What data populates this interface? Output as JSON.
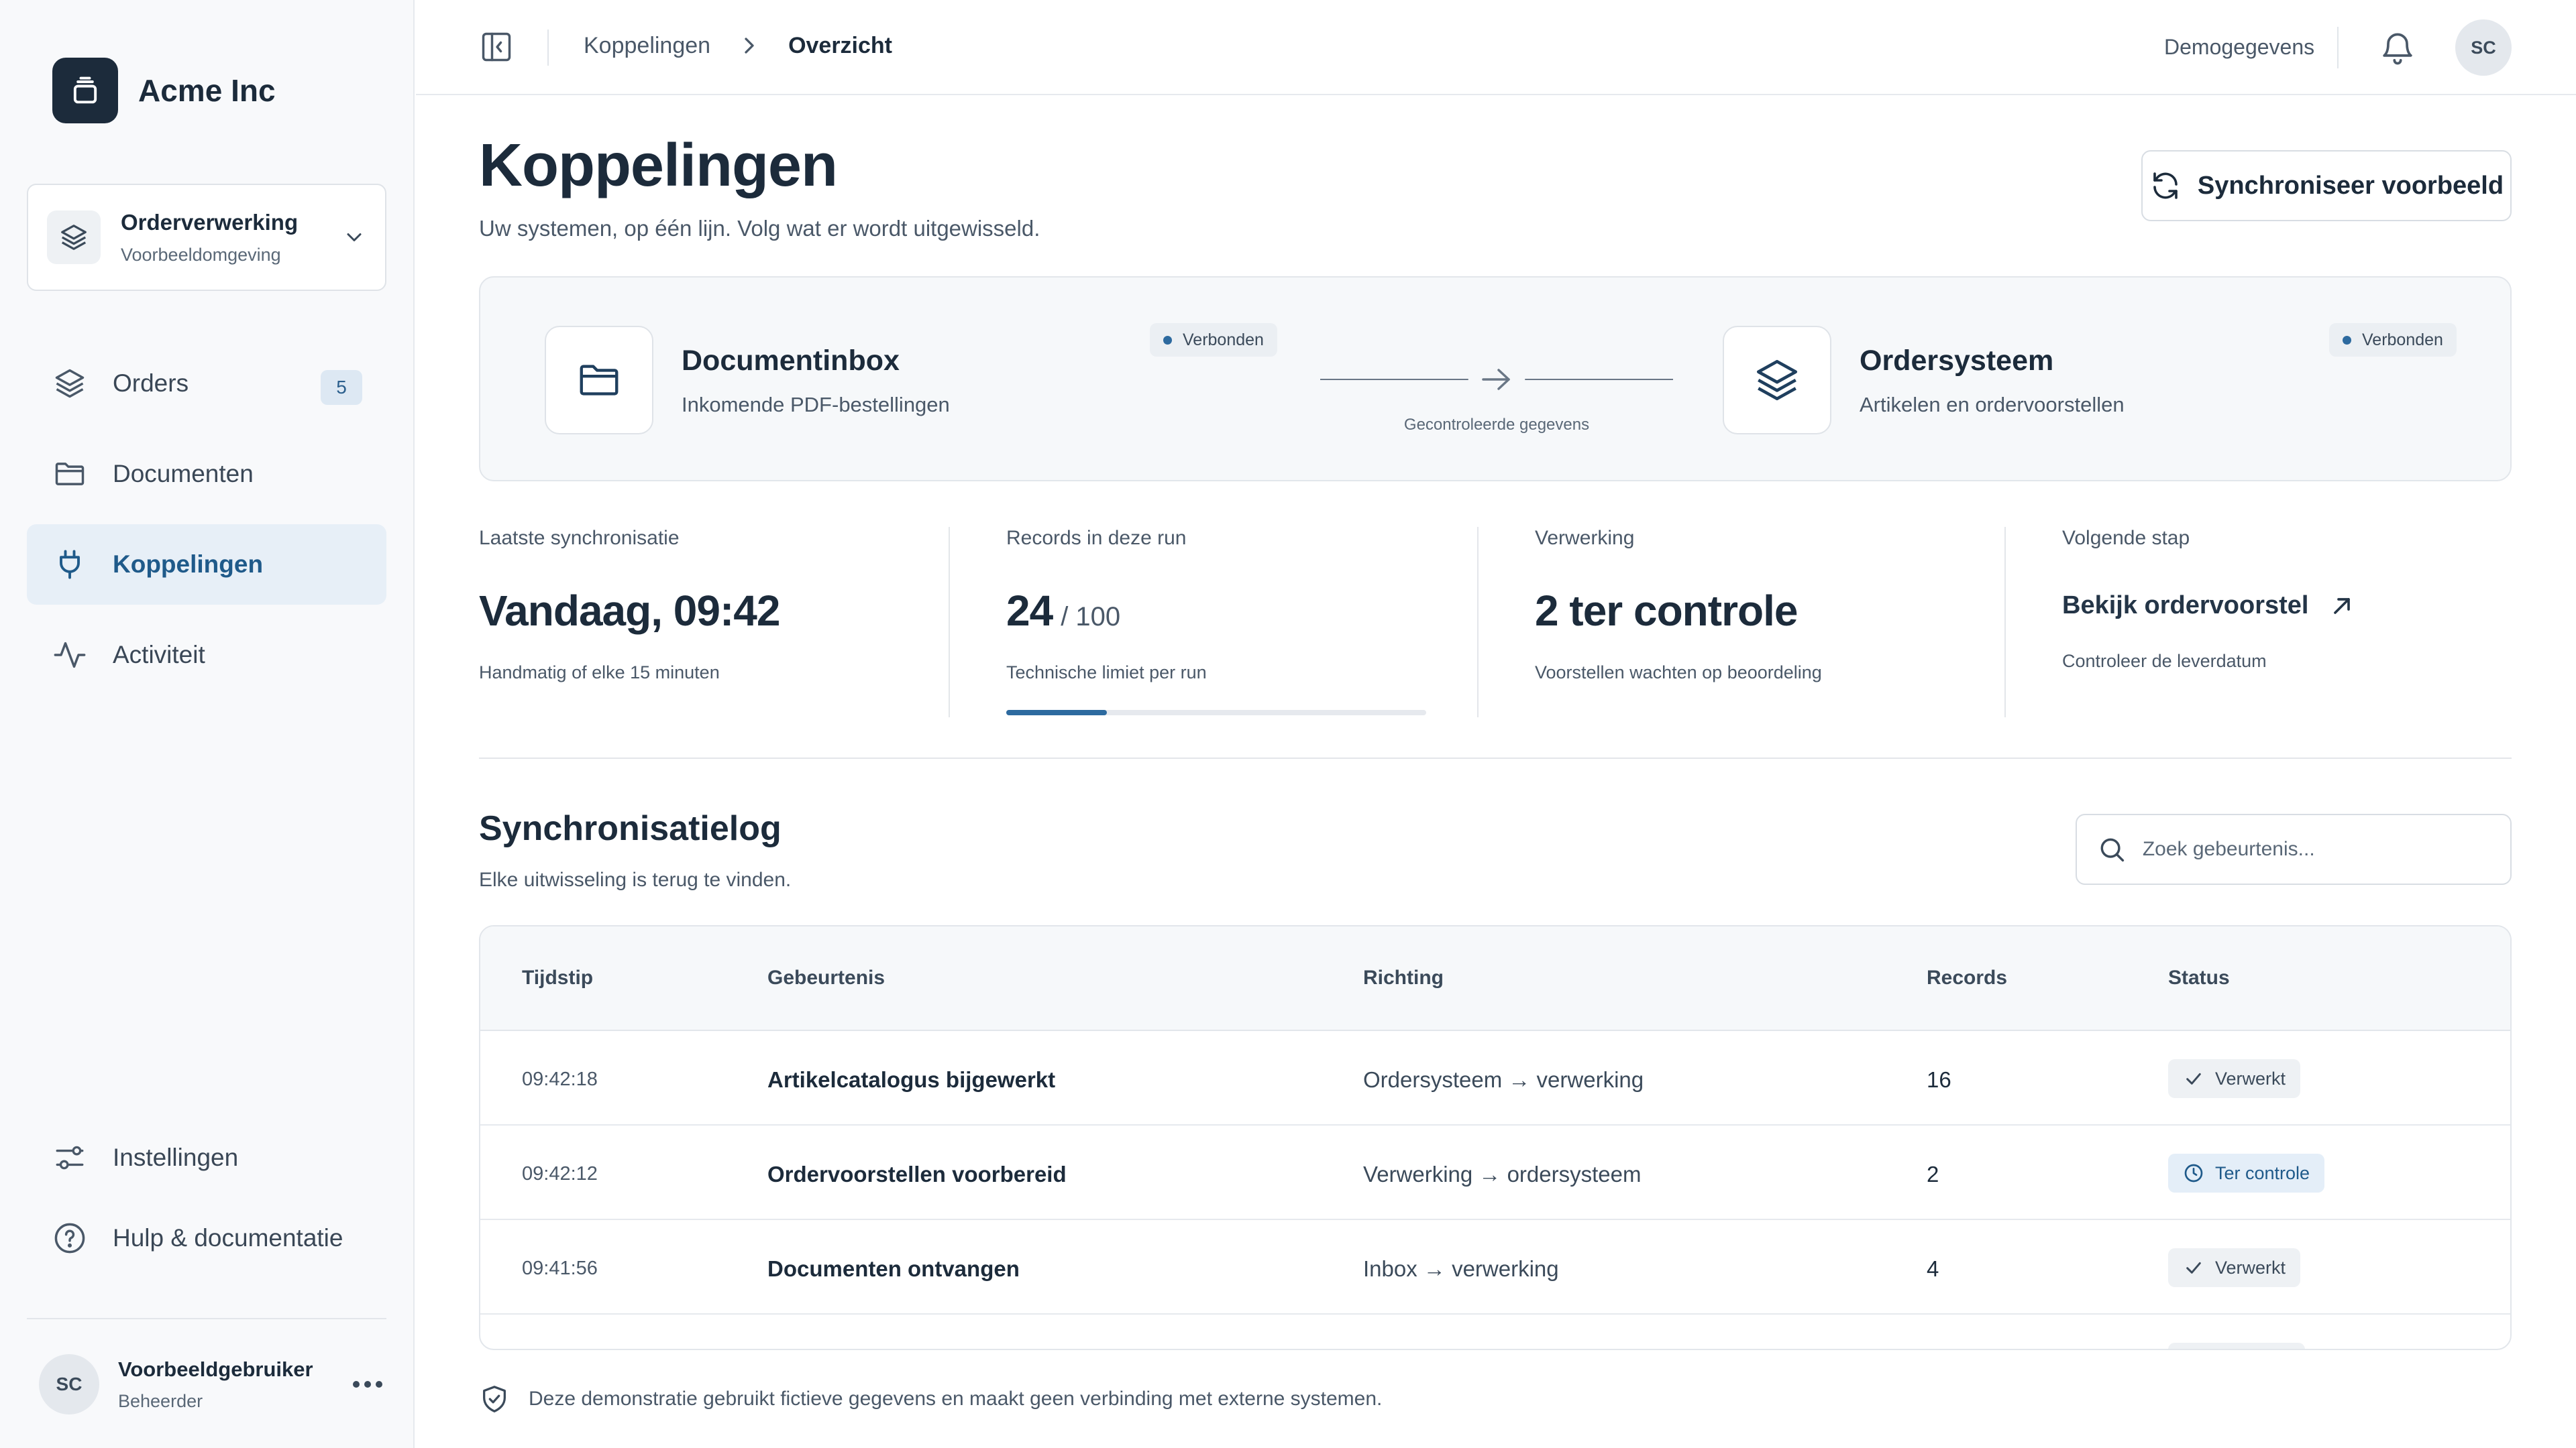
{
  "brand": {
    "name": "Acme Inc"
  },
  "workspace": {
    "title": "Orderverwerking",
    "subtitle": "Voorbeeldomgeving"
  },
  "sidebar": {
    "items": [
      {
        "label": "Orders",
        "icon": "layers-icon",
        "badge": "5"
      },
      {
        "label": "Documenten",
        "icon": "folder-icon"
      },
      {
        "label": "Koppelingen",
        "icon": "plug-icon",
        "active": true
      },
      {
        "label": "Activiteit",
        "icon": "activity-icon"
      }
    ],
    "bottom_items": [
      {
        "label": "Instellingen",
        "icon": "sliders-icon"
      },
      {
        "label": "Hulp & documentatie",
        "icon": "help-circle-icon"
      }
    ],
    "user": {
      "initials": "SC",
      "name": "Voorbeeldgebruiker",
      "role": "Beheerder"
    }
  },
  "topbar": {
    "breadcrumb": [
      "Koppelingen",
      "Overzicht"
    ],
    "demo_label": "Demogegevens",
    "user_initials": "SC"
  },
  "page": {
    "title": "Koppelingen",
    "subtitle": "Uw systemen, op één lijn. Volg wat er wordt uitgewisseld.",
    "sync_button": "Synchroniseer voorbeeld"
  },
  "connection": {
    "source": {
      "title": "Documentinbox",
      "subtitle": "Inkomende PDF-bestellingen",
      "status": "Verbonden"
    },
    "target": {
      "title": "Ordersysteem",
      "subtitle": "Artikelen en ordervoorstellen",
      "status": "Verbonden"
    },
    "flow_label": "Gecontroleerde gegevens"
  },
  "stats": {
    "last_sync": {
      "label": "Laatste synchronisatie",
      "value": "Vandaag, 09:42",
      "note": "Handmatig of elke 15 minuten"
    },
    "records": {
      "label": "Records in deze run",
      "value": "24",
      "limit": "/ 100",
      "note": "Technische limiet per run",
      "progress": 0.24
    },
    "processing": {
      "label": "Verwerking",
      "value": "2 ter controle",
      "note": "Voorstellen wachten op beoordeling"
    },
    "next_step": {
      "label": "Volgende stap",
      "link": "Bekijk ordervoorstel",
      "note": "Controleer de leverdatum"
    }
  },
  "log": {
    "title": "Synchronisatielog",
    "subtitle": "Elke uitwisseling is terug te vinden.",
    "search_placeholder": "Zoek gebeurtenis...",
    "columns": [
      "Tijdstip",
      "Gebeurtenis",
      "Richting",
      "Records",
      "Status"
    ],
    "rows": [
      {
        "time": "09:42:18",
        "event": "Artikelcatalogus bijgewerkt",
        "direction": "Ordersysteem → verwerking",
        "records": "16",
        "status": "Verwerkt",
        "status_type": "done"
      },
      {
        "time": "09:42:12",
        "event": "Ordervoorstellen voorbereid",
        "direction": "Verwerking → ordersysteem",
        "records": "2",
        "status": "Ter controle",
        "status_type": "review"
      },
      {
        "time": "09:41:56",
        "event": "Documenten ontvangen",
        "direction": "Inbox → verwerking",
        "records": "4",
        "status": "Verwerkt",
        "status_type": "done"
      }
    ]
  },
  "footer_note": "Deze demonstratie gebruikt fictieve gegevens en maakt geen verbinding met externe systemen.",
  "colors": {
    "accent": "#2d6a9f",
    "brand_dark": "#1c2b3b",
    "active_bg": "#e7eff7"
  }
}
